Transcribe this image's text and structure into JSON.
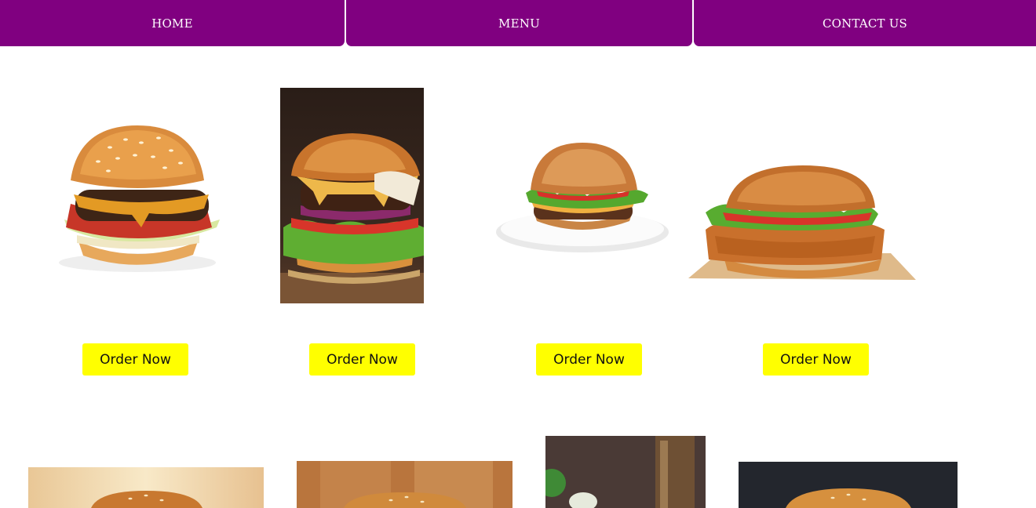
{
  "nav": {
    "items": [
      {
        "label": "HOME"
      },
      {
        "label": "MENU"
      },
      {
        "label": "CONTACT US"
      }
    ]
  },
  "menu": {
    "order_label": "Order Now",
    "products": [
      {
        "image": "classic-sesame-burger"
      },
      {
        "image": "cheeseburger-dark-background"
      },
      {
        "image": "burger-on-plate"
      },
      {
        "image": "crispy-chicken-sandwich"
      }
    ],
    "second_row": [
      {
        "image": "burger-warm-background"
      },
      {
        "image": "burger-wooden-background"
      },
      {
        "image": "burger-with-drink"
      },
      {
        "image": "burger-dark-background"
      }
    ]
  },
  "colors": {
    "nav_bg": "#800080",
    "nav_text": "#ffffff",
    "button_bg": "#ffff00",
    "button_text": "#111111",
    "page_bg": "#ffffff"
  }
}
